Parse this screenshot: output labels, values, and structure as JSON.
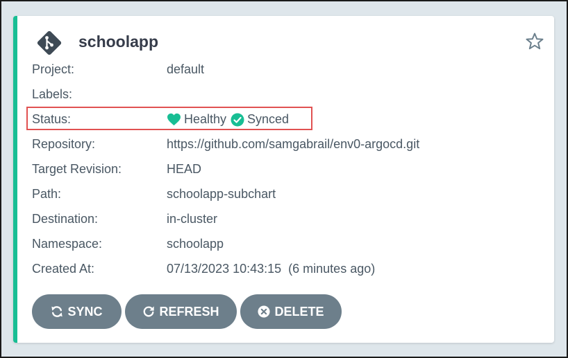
{
  "app": {
    "name": "schoolapp",
    "icon": "git-branch-icon",
    "star_icon": "star-outline-icon"
  },
  "details": {
    "project_label": "Project:",
    "project_value": "default",
    "labels_label": "Labels:",
    "labels_value": "",
    "status_label": "Status:",
    "health": "Healthy",
    "sync": "Synced",
    "repository_label": "Repository:",
    "repository_value": "https://github.com/samgabrail/env0-argocd.git",
    "target_revision_label": "Target Revision:",
    "target_revision_value": "HEAD",
    "path_label": "Path:",
    "path_value": "schoolapp-subchart",
    "destination_label": "Destination:",
    "destination_value": "in-cluster",
    "namespace_label": "Namespace:",
    "namespace_value": "schoolapp",
    "created_at_label": "Created At:",
    "created_at_value": "07/13/2023 10:43:15  (6 minutes ago)"
  },
  "actions": {
    "sync_label": "SYNC",
    "refresh_label": "REFRESH",
    "delete_label": "DELETE"
  },
  "colors": {
    "accent": "#18be94",
    "button": "#6d7f8b",
    "highlight": "#e15151",
    "text": "#495763"
  }
}
